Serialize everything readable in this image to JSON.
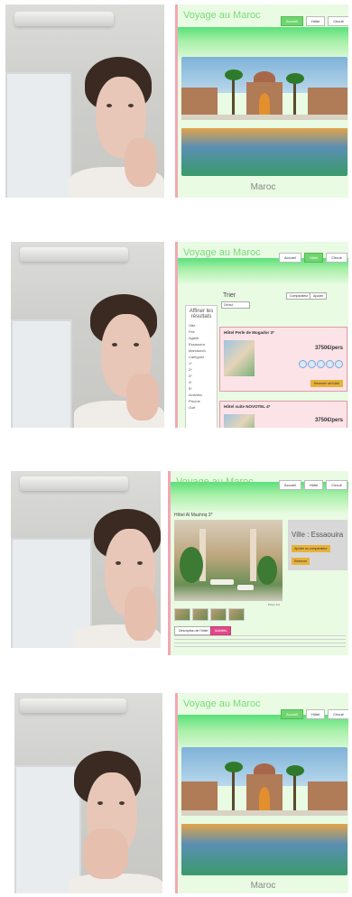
{
  "site_title": "Voyage au Maroc",
  "nav": [
    "Accueil",
    "Hôtel",
    "Circuit"
  ],
  "home": {
    "caption": "Maroc"
  },
  "results": {
    "filter_header": "Affiner les résultats",
    "filter_items": [
      "Ville",
      "Fès",
      "Agadir",
      "Essaouira",
      "Marrakech",
      "Catégorie",
      "1*",
      "2*",
      "3*",
      "4*",
      "5*",
      "Activités",
      "Piscine",
      "Golf",
      "Spa"
    ],
    "sort_label": "Trier",
    "sort_value": "Défaut",
    "buttons": [
      "Comparateur",
      "Ajouter"
    ],
    "hotels": [
      {
        "name": "Hôtel Perle de Mogador 3*",
        "price": "3750€/pers",
        "cta": "Réserver cet hôtel"
      },
      {
        "name": "Hôtel suite NOVOTEL 4*",
        "price": "3750€/pers",
        "cta": ""
      }
    ]
  },
  "detail": {
    "hotel_name": "Hôtel Al Mashriq 3*",
    "city": "Ville : Essaouira",
    "add_compare": "Ajouter au comparateur",
    "reserve": "Réserver",
    "tabs": [
      "Description de l'hôtel",
      "Activités"
    ],
    "photo_caption": "Photo 1/4"
  },
  "colors": {
    "accent_green": "#6fd66f",
    "pink_border": "#f2a7b4",
    "title_green": "#7ad97a",
    "cta_orange": "#e8b23a"
  }
}
